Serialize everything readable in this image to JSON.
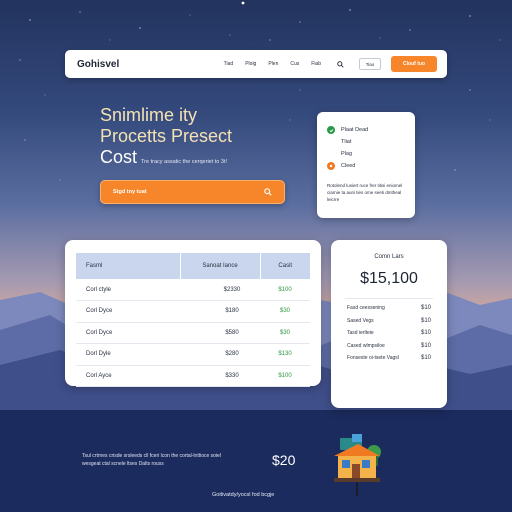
{
  "navbar": {
    "brand": "Gohisvel",
    "links": [
      "Tiad",
      "Ploig",
      "Plen",
      "Cus",
      "Fiab"
    ],
    "login_label": "Tiao",
    "cta_label": "Clouf tuo"
  },
  "hero": {
    "title_line1": "Snimlime ity",
    "title_line2": "Procetts Presect",
    "title_cost": "Cost",
    "description": "Tre tracy assatic the cerqeriet to 3t!",
    "search_placeholder": "Stgd tny tuat"
  },
  "options": {
    "items": [
      {
        "label": "Plaat Dead",
        "icon": "check-circle-icon",
        "color": "#2a9a4a"
      },
      {
        "label": "Tliat",
        "icon": "none"
      },
      {
        "label": "Plag",
        "icon": "none"
      },
      {
        "label": "Cleed",
        "icon": "circle-icon",
        "color": "#f07a22"
      }
    ],
    "note": "Rotolend lusiert ruce frer titisi eniomel ciarnie ta auni ties ome seeti dmtheal leicrre"
  },
  "table": {
    "headers": [
      "Fasml",
      "Sanoat Iance",
      "Casit"
    ],
    "rows": [
      {
        "name": "Corl ctyle",
        "amount": "$2330",
        "cost": "$100"
      },
      {
        "name": "Corl Dyce",
        "amount": "$180",
        "cost": "$30"
      },
      {
        "name": "Corl Dyce",
        "amount": "$580",
        "cost": "$30"
      },
      {
        "name": "Dorl Dyle",
        "amount": "$280",
        "cost": "$130"
      },
      {
        "name": "Corl Ayce",
        "amount": "$330",
        "cost": "$100"
      }
    ]
  },
  "summary": {
    "title": "Comn Lars",
    "total": "$15,100",
    "rows": [
      {
        "label": "Fasd ceexsening",
        "value": "$10"
      },
      {
        "label": "Sased Vegs",
        "value": "$10"
      },
      {
        "label": "Tasd ierlteie",
        "value": "$10"
      },
      {
        "label": "Cased wlmpsiloe",
        "value": "$10"
      },
      {
        "label": "Fonseste oi-tsete Vagsl",
        "value": "$10"
      }
    ]
  },
  "footer": {
    "text": "Tsul crtrnes crisde srsleeds cll fceri lcon the cortal-lnttioce soiel wesgeat ctal scnele ltses Dalts rouss",
    "price": "$20",
    "tagline": "Goitivatdy/yocsl fod bcgje"
  },
  "colors": {
    "accent": "#f7862a",
    "positive": "#2d9a3e",
    "hero_title": "#f4e2b4",
    "table_header": "#c9d6ee"
  }
}
